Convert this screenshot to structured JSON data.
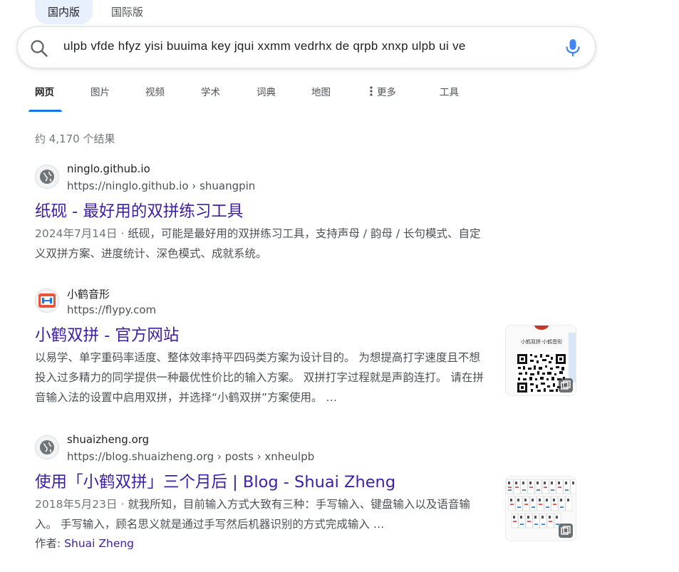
{
  "region_tabs": [
    {
      "label": "国内版",
      "active": true
    },
    {
      "label": "国际版",
      "active": false
    }
  ],
  "search": {
    "query": "ulpb vfde hfyz yisi buuima key jqui xxmm vedrhx de qrpb xnxp ulpb ui ve"
  },
  "nav": {
    "web": "网页",
    "images": "图片",
    "videos": "视频",
    "academic": "学术",
    "dictionary": "词典",
    "maps": "地图",
    "more": "更多",
    "tools": "工具"
  },
  "results_count": "约 4,170 个结果",
  "results": [
    {
      "site_name": "ninglo.github.io",
      "url": "https://ninglo.github.io › shuangpin",
      "title": "纸砚 - 最好用的双拼练习工具",
      "date": "2024年7月14日 · ",
      "snippet": "纸砚，可能是最好用的双拼练习工具，支持声母 / 韵母 / 长句模式、自定义双拼方案、进度统计、深色模式、成就系统。"
    },
    {
      "site_name": "小鹤音形",
      "url": "https://flypy.com",
      "title": "小鹤双拼 - 官方网站",
      "date": "",
      "snippet": "以易学、单字重码率适度、整体效率持平四码类方案为设计目的。 为想提高打字速度且不想投入过多精力的同学提供一种最优性价比的输入方案。 双拼打字过程就是声韵连打。 请在拼音输入法的设置中启用双拼，并选择“小鹤双拼”方案使用。 …",
      "thumb_caption": "小鹤双拼·小鹤音形"
    },
    {
      "site_name": "shuaizheng.org",
      "url": "https://blog.shuaizheng.org › posts › xnheulpb",
      "title": "使用「小鹤双拼」三个月后 | Blog - Shuai Zheng",
      "date": "2018年5月23日 · ",
      "snippet": "就我所知，目前输入方式大致有三种：手写输入、键盘输入以及语音输入。 手写输入，顾名思义就是通过手写然后机器识别的方式完成输入 …",
      "author_label": "作者: ",
      "author_name": "Shuai Zheng"
    }
  ],
  "colors": {
    "link": "#3c1fa3",
    "accent": "#1a73e8",
    "muted": "#4d5156"
  }
}
